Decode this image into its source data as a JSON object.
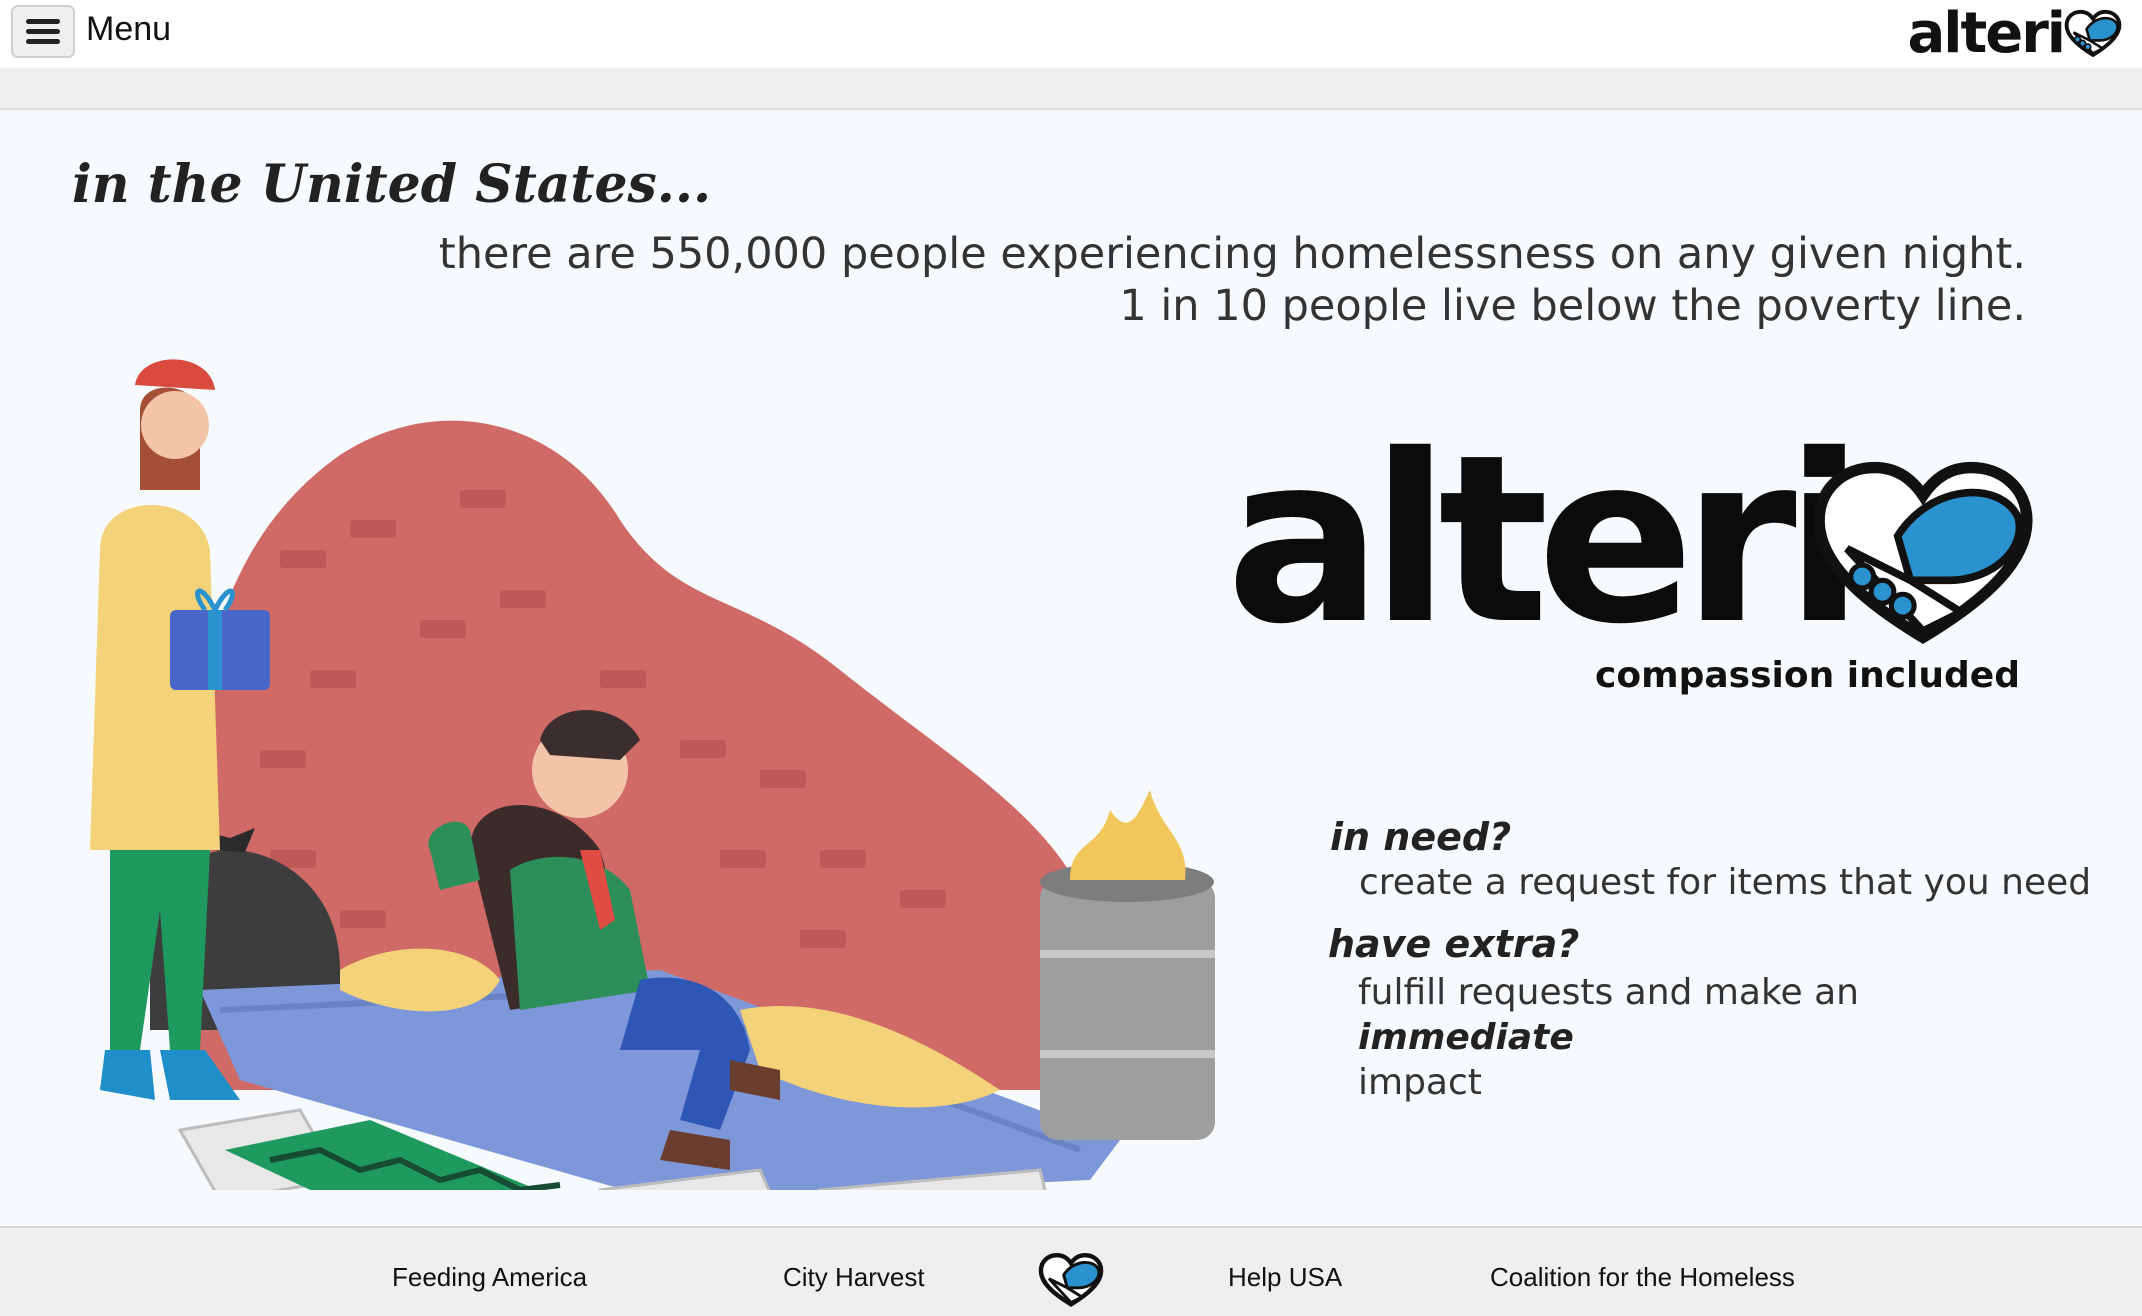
{
  "header": {
    "menu_label": "Menu",
    "logo_text": "alteri"
  },
  "hero": {
    "heading": "in the United States...",
    "stat_line_1": "there are 550,000 people experiencing homelessness on any given night.",
    "stat_line_2": "1 in 10 people live below the poverty line.",
    "logo_text": "alteri",
    "tagline": "compassion included",
    "need_question": "in need?",
    "need_answer": "create a request for items that you need",
    "extra_question": "have extra?",
    "extra_answer_pre": "fulfill requests and make an ",
    "extra_answer_em": "immediate",
    "extra_answer_post": "impact"
  },
  "footer": {
    "links": [
      "Feeding America",
      "City Harvest",
      "Help USA",
      "Coalition for the Homeless"
    ]
  },
  "colors": {
    "brand_blue": "#2a93cf",
    "brick_red": "#d06a66",
    "text_dark": "#111111"
  },
  "icons": [
    "menu-icon",
    "heart-handshake-icon"
  ]
}
